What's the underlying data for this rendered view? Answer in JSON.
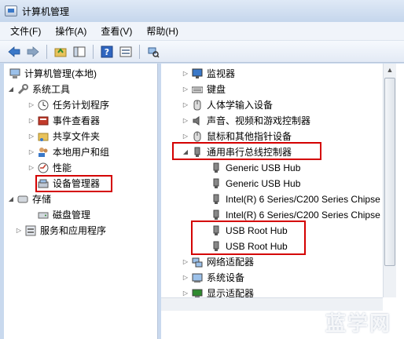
{
  "window": {
    "title": "计算机管理"
  },
  "menu": [
    {
      "label": "文件(F)"
    },
    {
      "label": "操作(A)"
    },
    {
      "label": "查看(V)"
    },
    {
      "label": "帮助(H)"
    }
  ],
  "toolbar": {
    "icons": [
      "back-arrow-icon",
      "forward-arrow-icon",
      "up-folder-icon",
      "show-hide-tree-icon",
      "help-icon",
      "properties-icon",
      "scan-hardware-icon"
    ]
  },
  "tree": {
    "root": "计算机管理(本地)",
    "system_tools": "系统工具",
    "task_scheduler": "任务计划程序",
    "event_viewer": "事件查看器",
    "shared_folders": "共享文件夹",
    "local_users": "本地用户和组",
    "performance": "性能",
    "device_manager": "设备管理器",
    "storage": "存储",
    "disk_management": "磁盘管理",
    "services_apps": "服务和应用程序"
  },
  "devices": {
    "monitors": "监视器",
    "keyboards": "键盘",
    "hid": "人体学输入设备",
    "sound": "声音、视频和游戏控制器",
    "mice": "鼠标和其他指针设备",
    "usb_controllers": "通用串行总线控制器",
    "usb_items": [
      "Generic USB Hub",
      "Generic USB Hub",
      "Intel(R) 6 Series/C200 Series Chipse",
      "Intel(R) 6 Series/C200 Series Chipse",
      "USB Root Hub",
      "USB Root Hub"
    ],
    "network": "网络适配器",
    "system": "系统设备",
    "display": "显示适配器"
  },
  "watermark": {
    "text": "蓝学网"
  },
  "colors": {
    "highlight": "#d40000",
    "accent": "#3a78c8"
  }
}
